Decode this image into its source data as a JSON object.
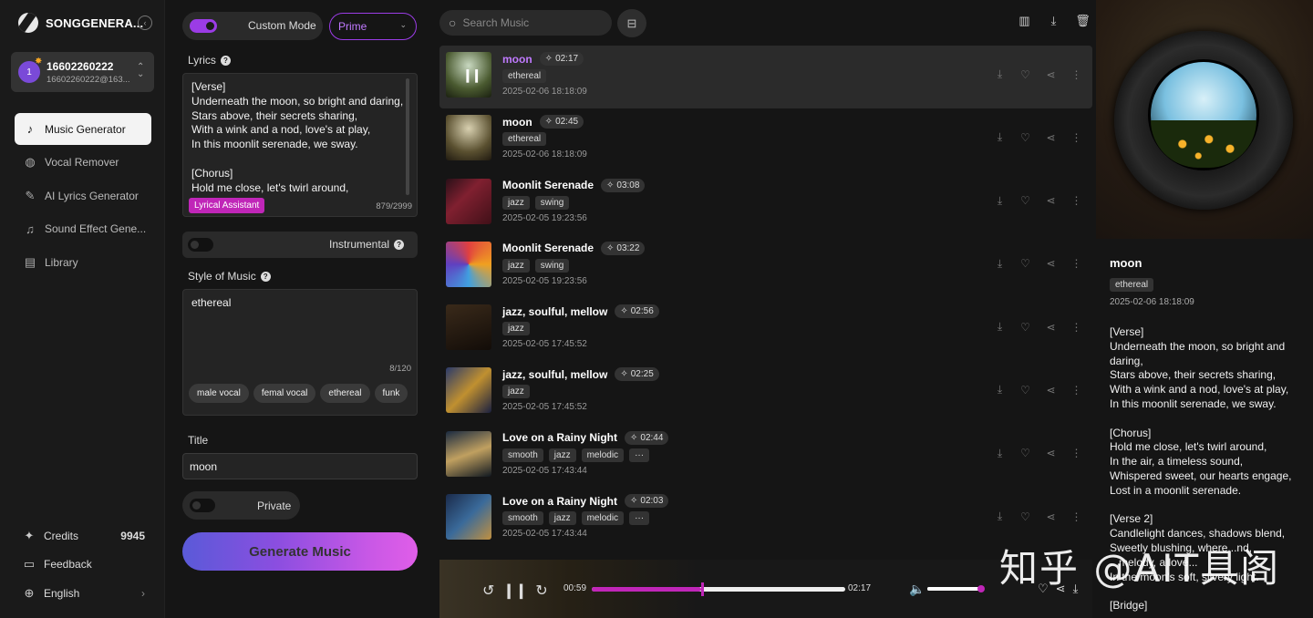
{
  "brand": {
    "name": "SONGGENERA..."
  },
  "account": {
    "initial": "1",
    "name": "16602260222",
    "email": "16602260222@163..."
  },
  "nav": [
    {
      "label": "Music Generator",
      "icon": "music-note-icon"
    },
    {
      "label": "Vocal Remover",
      "icon": "vocal-remover-icon"
    },
    {
      "label": "AI Lyrics Generator",
      "icon": "lyrics-icon"
    },
    {
      "label": "Sound Effect Gene...",
      "icon": "sound-effect-icon"
    },
    {
      "label": "Library",
      "icon": "library-icon"
    }
  ],
  "credits": {
    "label": "Credits",
    "value": "9945"
  },
  "feedback": "Feedback",
  "language": "English",
  "form": {
    "mode_label": "Custom Mode",
    "model": "Prime",
    "lyrics_label": "Lyrics",
    "lyrics": "[Verse]\nUnderneath the moon, so bright and daring,\nStars above, their secrets sharing,\nWith a wink and a nod, love's at play,\nIn this moonlit serenade, we sway.\n\n[Chorus]\nHold me close, let's twirl around,",
    "lyrics_count": "879/2999",
    "assistant": "Lyrical Assistant",
    "instrumental": "Instrumental",
    "style_label": "Style of Music",
    "style": "ethereal",
    "style_count": "8/120",
    "chips": [
      "male vocal",
      "femal vocal",
      "ethereal",
      "funk"
    ],
    "title_label": "Title",
    "title": "moon",
    "private": "Private",
    "generate": "Generate Music"
  },
  "search": {
    "placeholder": "Search Music"
  },
  "songs": [
    {
      "title": "moon",
      "duration": "02:17",
      "tags": [
        "ethereal"
      ],
      "date": "2025-02-06 18:18:09",
      "active": true
    },
    {
      "title": "moon",
      "duration": "02:45",
      "tags": [
        "ethereal"
      ],
      "date": "2025-02-06 18:18:09"
    },
    {
      "title": "Moonlit Serenade",
      "duration": "03:08",
      "tags": [
        "jazz",
        "swing"
      ],
      "date": "2025-02-05 19:23:56"
    },
    {
      "title": "Moonlit Serenade",
      "duration": "03:22",
      "tags": [
        "jazz",
        "swing"
      ],
      "date": "2025-02-05 19:23:56"
    },
    {
      "title": "jazz, soulful, mellow",
      "duration": "02:56",
      "tags": [
        "jazz"
      ],
      "date": "2025-02-05 17:45:52"
    },
    {
      "title": "jazz, soulful, mellow",
      "duration": "02:25",
      "tags": [
        "jazz"
      ],
      "date": "2025-02-05 17:45:52"
    },
    {
      "title": "Love on a Rainy Night",
      "duration": "02:44",
      "tags": [
        "smooth",
        "jazz",
        "melodic",
        "···"
      ],
      "date": "2025-02-05 17:43:44"
    },
    {
      "title": "Love on a Rainy Night",
      "duration": "02:03",
      "tags": [
        "smooth",
        "jazz",
        "melodic",
        "···"
      ],
      "date": "2025-02-05 17:43:44"
    }
  ],
  "player": {
    "current": "00:59",
    "total": "02:17",
    "progress": 0.43,
    "volume": 0.95
  },
  "detail": {
    "title": "moon",
    "tag": "ethereal",
    "date": "2025-02-06 18:18:09",
    "lyrics": "[Verse]\nUnderneath the moon, so bright and daring,\nStars above, their secrets sharing,\nWith a wink and a nod, love's at play,\nIn this moonlit serenade, we sway.\n\n[Chorus]\nHold me close, let's twirl around,\nIn the air, a timeless sound,\nWhispered sweet, our hearts engage,\nLost in a moonlit serenade.\n\n[Verse 2]\nCandlelight dances, shadows blend,\nSweetly blushing, where...nd,\n...melody, a love...\nIn the moon's soft, silvery light.\n\n[Bridge]"
  },
  "watermark": "知乎 @AIT具阁",
  "colors": {
    "accent": "#9b3ce6",
    "accent_pink": "#c026b8",
    "bg": "#151515"
  }
}
